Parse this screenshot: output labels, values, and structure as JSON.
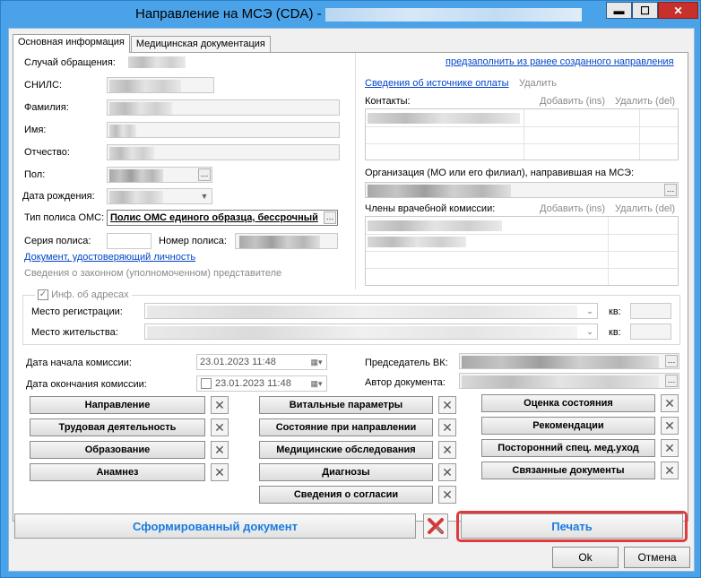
{
  "window": {
    "title": "Направление на МСЭ (CDA) -",
    "minimize": "▬",
    "maximize": "☐",
    "close": "✕"
  },
  "tabs": [
    {
      "label": "Основная информация"
    },
    {
      "label": "Медицинская документация"
    }
  ],
  "left": {
    "case_label": "Случай обращения:",
    "prefill_link": "предзаполнить из ранее созданного направления",
    "snils_label": "СНИЛС:",
    "surname_label": "Фамилия:",
    "name_label": "Имя:",
    "patronymic_label": "Отчество:",
    "sex_label": "Пол:",
    "birthdate_label": "Дата рождения:",
    "policy_type_label": "Тип полиса ОМС:",
    "policy_type_value": "Полис ОМС единого образца, бессрочный",
    "policy_series_label": "Серия полиса:",
    "policy_number_label": "Номер полиса:",
    "identity_doc_link": "Документ, удостоверяющий личность",
    "representative_text": "Сведения о законном (уполномоченном) представителе"
  },
  "right": {
    "payment_source_link": "Сведения об источнике оплаты",
    "payment_delete": "Удалить",
    "contacts_label": "Контакты:",
    "add_ins": "Добавить (ins)",
    "del_del": "Удалить (del)",
    "org_label": "Организация (МО или его филиал), направившая на МСЭ:",
    "commission_label": "Члены врачебной комиссии:"
  },
  "address": {
    "group_label": "Инф. об адресах",
    "registration_label": "Место регистрации:",
    "residence_label": "Место жительства:",
    "apt_label": "кв:"
  },
  "commission": {
    "start_label": "Дата начала комиссии:",
    "start_value": "23.01.2023 11:48",
    "end_label": "Дата окончания комиссии:",
    "end_value": "23.01.2023 11:48",
    "chair_label": "Председатель ВК:",
    "author_label": "Автор документа:"
  },
  "sections": {
    "col1": [
      "Направление",
      "Трудовая деятельность",
      "Образование",
      "Анамнез"
    ],
    "col2": [
      "Витальные параметры",
      "Состояние при направлении",
      "Медицинские обследования",
      "Диагнозы",
      "Сведения о согласии"
    ],
    "col3": [
      "Оценка состояния",
      "Рекомендации",
      "Посторонний спец. мед.уход",
      "Связанные документы"
    ]
  },
  "bottom": {
    "generated_doc": "Сформированный документ",
    "print": "Печать",
    "ok": "Ok",
    "cancel": "Отмена"
  },
  "colors": {
    "accent": "#1a7be0",
    "highlight": "#e0393e"
  }
}
